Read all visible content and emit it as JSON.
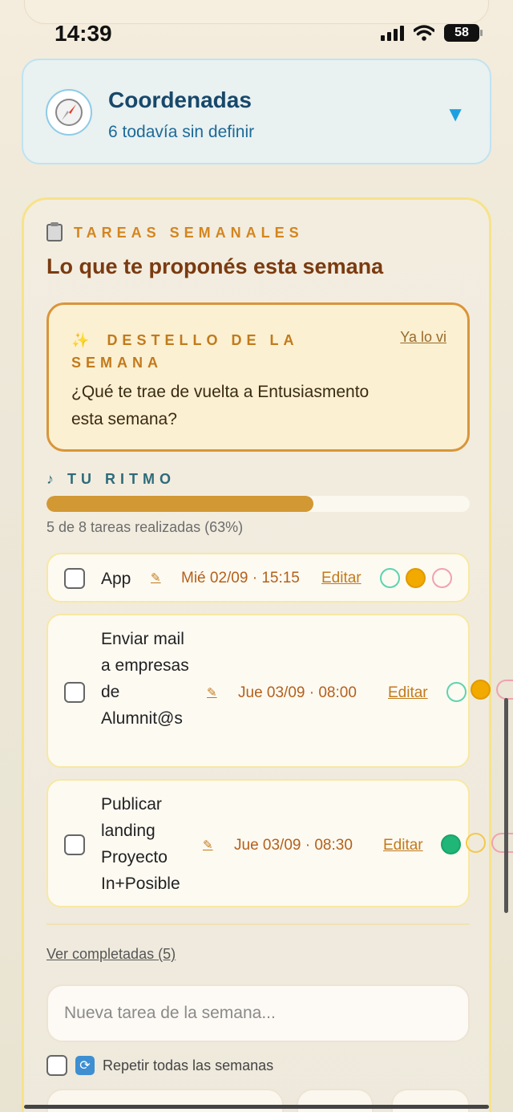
{
  "status_bar": {
    "time": "14:39",
    "battery": "58"
  },
  "coordinates": {
    "icon": "compass-icon",
    "title": "Coordenadas",
    "subtitle": "6 todavía sin definir"
  },
  "weekly": {
    "label": "TAREAS SEMANALES",
    "title": "Lo que te proponés esta semana",
    "spark": {
      "label": "DESTELLO DE LA SEMANA",
      "dismiss": "Ya lo vi",
      "text": "¿Qué te trae de vuelta a Entusiasmento esta semana?"
    },
    "rhythm": {
      "label": "TU RITMO",
      "progress_fraction": 0.63,
      "summary": "5 de 8 tareas realizadas (63%)"
    },
    "tasks": [
      {
        "name": "App",
        "pencil": "✎",
        "date": "Mié 02/09 · 15:15",
        "edit": "Editar",
        "dots": [
          "outline-teal",
          "filled-orange",
          "outline-pink"
        ]
      },
      {
        "name": "Enviar mail a empresas de Alumnit@s",
        "pencil": "✎",
        "date": "Jue 03/09 · 08:00",
        "edit": "Editar",
        "dots": [
          "outline-teal",
          "filled-orange",
          "outline-pink"
        ]
      },
      {
        "name": "Publicar landing Proyecto In+Posible",
        "pencil": "✎",
        "date": "Jue 03/09 · 08:30",
        "edit": "Editar",
        "dots": [
          "filled-green",
          "outline-orange",
          "outline-pink"
        ]
      }
    ],
    "see_completed": "Ver completadas (5)",
    "new_task_placeholder": "Nueva tarea de la semana...",
    "repeat_label": "Repetir todas las semanas"
  },
  "colors": {
    "accent_orange": "#d29834",
    "teal": "#5ed3b0",
    "green": "#1fb678",
    "pink": "#f0a2b0",
    "blue": "#1ea0e0"
  }
}
